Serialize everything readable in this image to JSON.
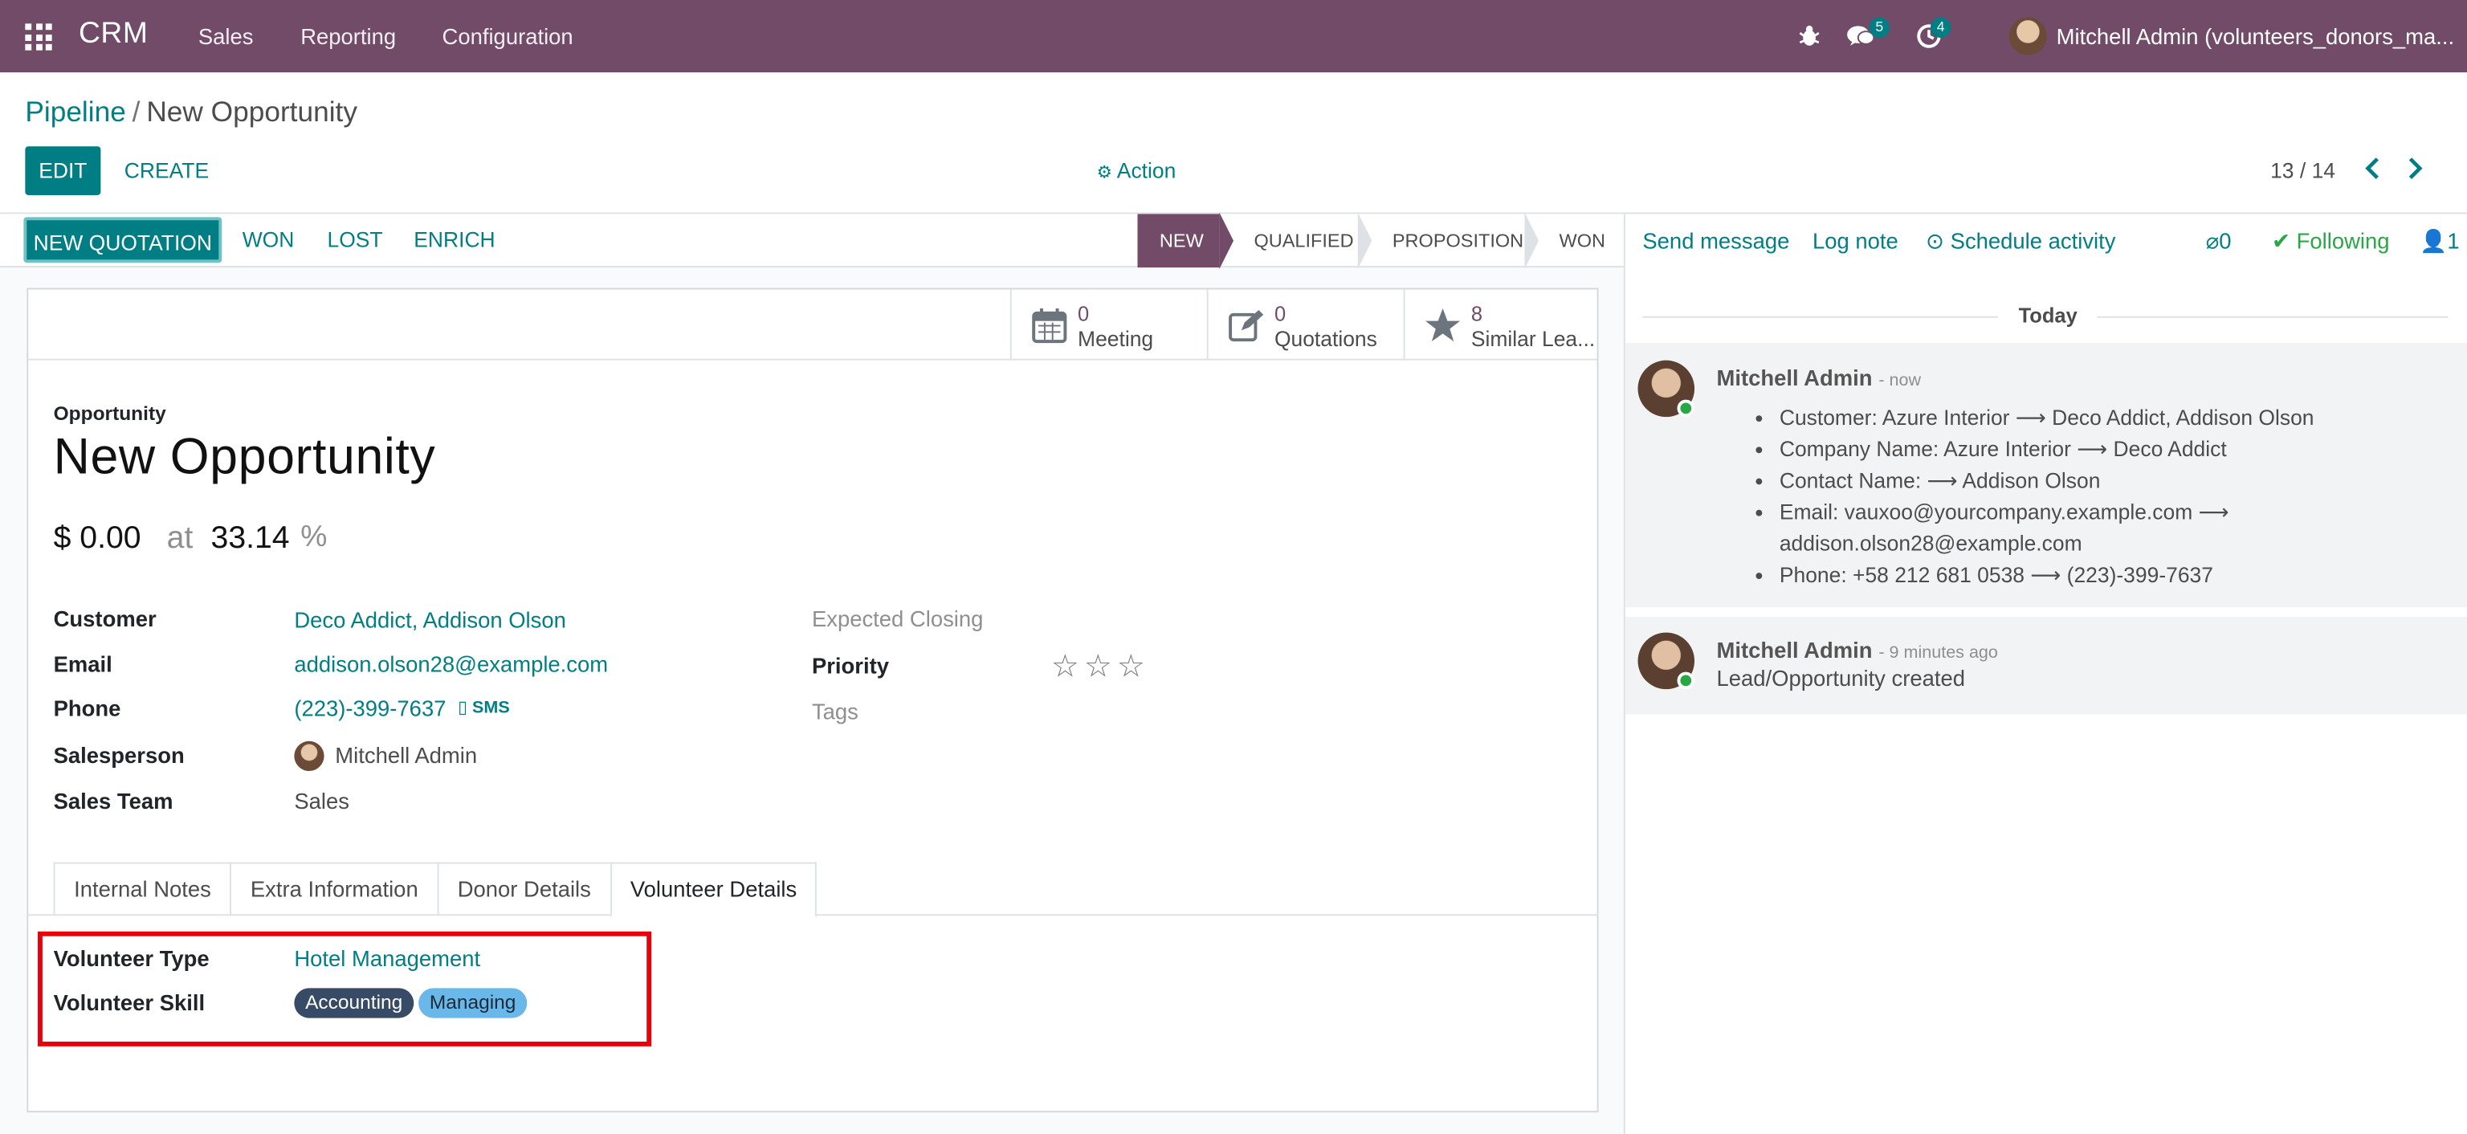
{
  "navbar": {
    "brand": "CRM",
    "menu": [
      "Sales",
      "Reporting",
      "Configuration"
    ],
    "chat_badge": "5",
    "activity_badge": "4",
    "user": "Mitchell Admin (volunteers_donors_ma..."
  },
  "control": {
    "breadcrumb_parent": "Pipeline",
    "breadcrumb_sep": "/",
    "breadcrumb_current": "New Opportunity",
    "edit": "EDIT",
    "create": "CREATE",
    "action": "Action",
    "pager": "13 / 14"
  },
  "statusbar": {
    "buttons": [
      "NEW QUOTATION",
      "WON",
      "LOST",
      "ENRICH"
    ],
    "stages": [
      "NEW",
      "QUALIFIED",
      "PROPOSITION",
      "WON"
    ],
    "active_stage": "NEW"
  },
  "smart_buttons": [
    {
      "count": "0",
      "label": "Meeting",
      "icon": "calendar-icon"
    },
    {
      "count": "0",
      "label": "Quotations",
      "icon": "edit-icon"
    },
    {
      "count": "8",
      "label": "Similar Lea...",
      "icon": "star-icon"
    }
  ],
  "form": {
    "type_label": "Opportunity",
    "title": "New Opportunity",
    "revenue": "$ 0.00",
    "at": "at",
    "probability": "33.14",
    "percent": "%",
    "fields": {
      "customer_label": "Customer",
      "customer": "Deco Addict, Addison Olson",
      "email_label": "Email",
      "email": "addison.olson28@example.com",
      "phone_label": "Phone",
      "phone": "(223)-399-7637",
      "sms": "SMS",
      "salesperson_label": "Salesperson",
      "salesperson": "Mitchell Admin",
      "team_label": "Sales Team",
      "team": "Sales",
      "closing_label": "Expected Closing",
      "priority_label": "Priority",
      "priority_stars": "0 of 3",
      "tags_label": "Tags"
    },
    "tabs": [
      "Internal Notes",
      "Extra Information",
      "Donor Details",
      "Volunteer Details"
    ],
    "active_tab": "Volunteer Details",
    "volunteer": {
      "type_label": "Volunteer Type",
      "type": "Hotel Management",
      "skill_label": "Volunteer Skill",
      "skills": [
        "Accounting",
        "Managing"
      ]
    }
  },
  "chatter": {
    "send": "Send message",
    "log": "Log note",
    "schedule": "Schedule activity",
    "attachments": "0",
    "following": "Following",
    "followers": "1",
    "date_sep": "Today",
    "messages": [
      {
        "author": "Mitchell Admin",
        "date": "- now",
        "changes": [
          "Customer: Azure Interior ⟶ Deco Addict, Addison Olson",
          "Company Name: Azure Interior ⟶ Deco Addict",
          "Contact Name: ⟶ Addison Olson",
          "Email: vauxoo@yourcompany.example.com ⟶ addison.olson28@example.com",
          "Phone: +58 212 681 0538 ⟶ (223)-399-7637"
        ]
      },
      {
        "author": "Mitchell Admin",
        "date": "- 9 minutes ago",
        "body": "Lead/Opportunity created"
      }
    ]
  },
  "colors": {
    "brand": "#714b67",
    "primary": "#017e84",
    "highlight": "#e8000b",
    "tag_dark": "#374a66",
    "tag_light": "#6ab7ea"
  }
}
